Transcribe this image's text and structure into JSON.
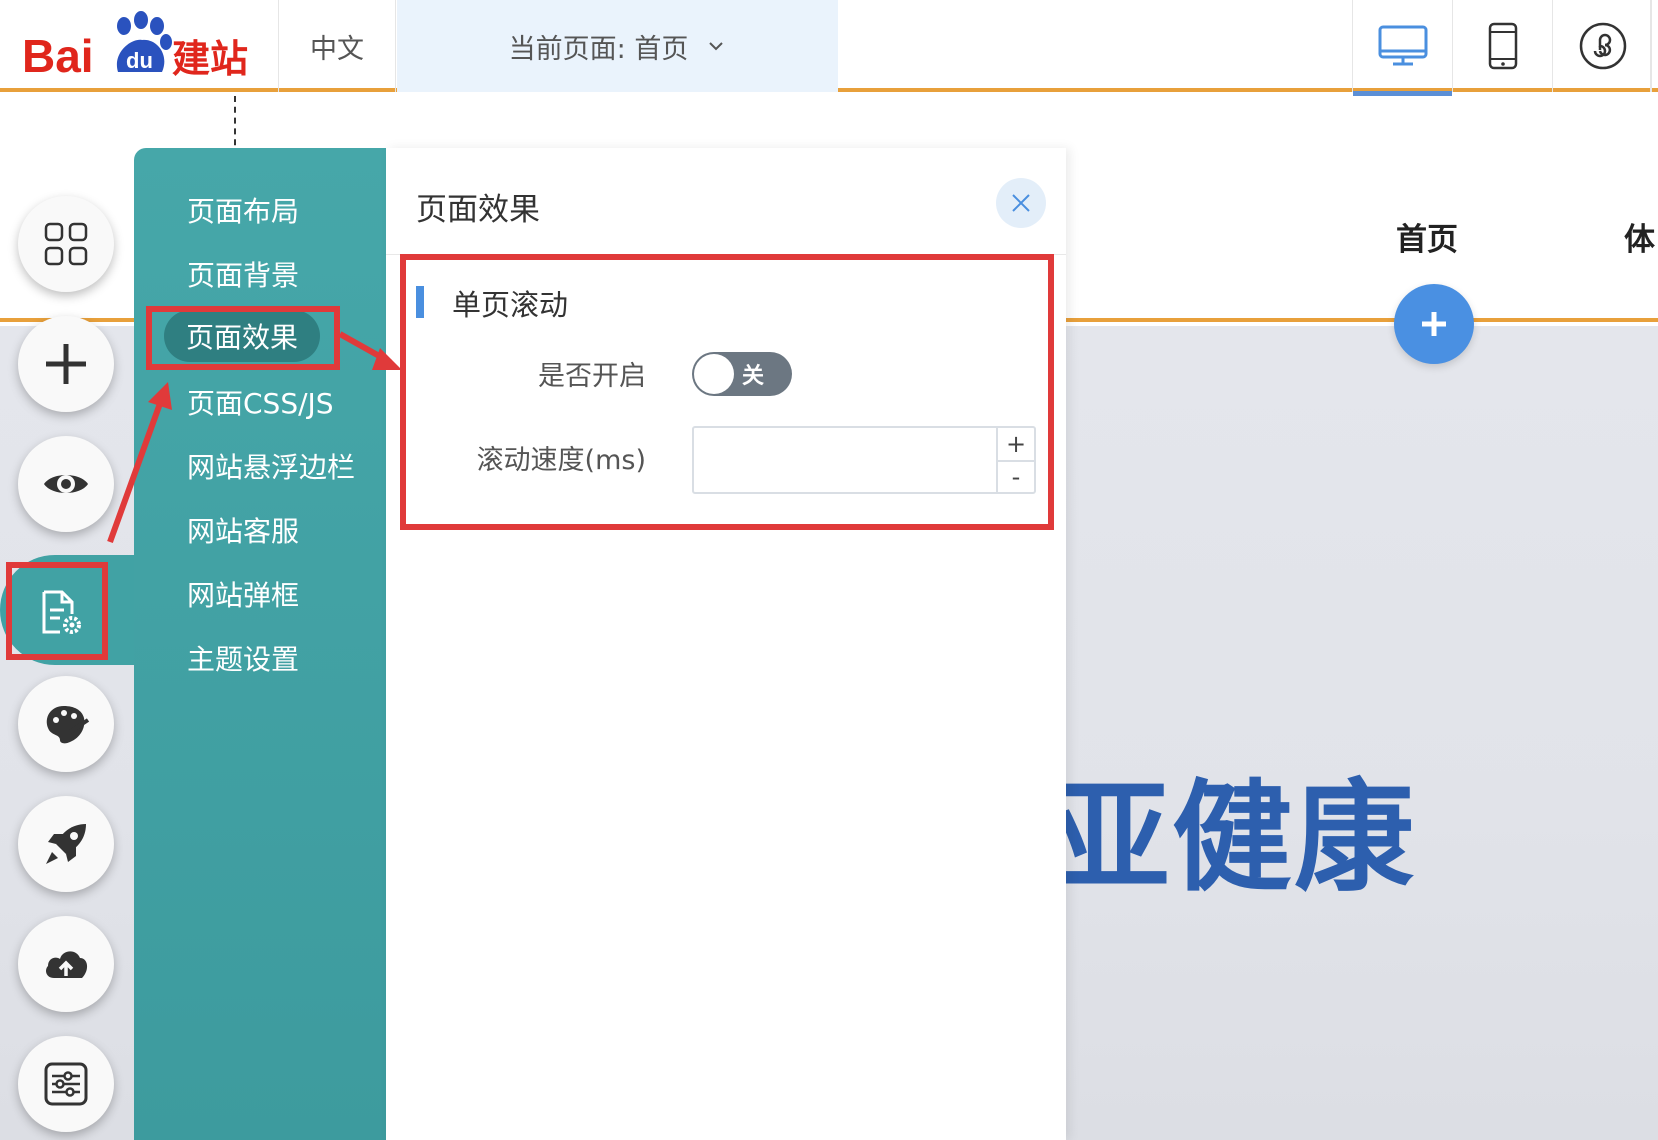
{
  "topbar": {
    "logo_text_1": "Bai",
    "logo_text_2": "du",
    "logo_text_3": "建站",
    "language": "中文",
    "current_page": "当前页面: 首页",
    "devices": [
      "desktop-icon",
      "mobile-icon",
      "mini-program-icon"
    ]
  },
  "site": {
    "nav_items": [
      "首页",
      "体"
    ],
    "banner_text": "亚健康"
  },
  "tools": [
    "grid-icon",
    "plus-icon",
    "eye-icon",
    "page-settings-icon",
    "palette-icon",
    "rocket-icon",
    "cloud-upload-icon",
    "sliders-icon"
  ],
  "sidemenu": {
    "items": [
      "页面布局",
      "页面背景",
      "页面效果",
      "页面CSS/JS",
      "网站悬浮边栏",
      "网站客服",
      "网站弹框",
      "主题设置"
    ],
    "active": "页面效果"
  },
  "panel": {
    "title": "页面效果",
    "section_title": "单页滚动",
    "enable_label": "是否开启",
    "toggle_state": "关",
    "speed_label": "滚动速度(ms)",
    "speed_value": "",
    "step_up": "+",
    "step_down": "-"
  },
  "colors": {
    "accent_teal": "#41a2a4",
    "orange_line": "#e8a03b",
    "annotation_red": "#e03a3a",
    "primary_blue": "#4a90e2"
  }
}
